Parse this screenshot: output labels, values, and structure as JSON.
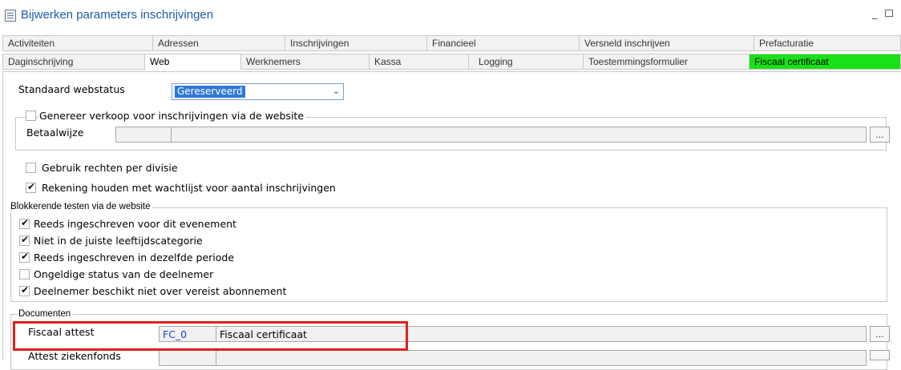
{
  "window": {
    "title": "Bijwerken parameters inschrijvingen"
  },
  "tabs_row1": [
    "Activiteiten",
    "Adressen",
    "Inschrijvingen",
    "Financieel",
    "Versneld inschrijven",
    "Prefacturatie"
  ],
  "tabs_row2": [
    "Daginschrijving",
    "Web",
    "Werknemers",
    "Kassa",
    "Logging",
    "Toestemmingsformulier",
    "Fiscaal certificaat"
  ],
  "active_tab": "Web",
  "highlight_color": "#17e217",
  "web": {
    "status_label": "Standaard webstatus",
    "status_value": "Gereserveerd",
    "sales_group_label": "Genereer verkoop voor inschrijvingen via de website",
    "payment_label": "Betaalwijze",
    "division_rights_label": "Gebruik rechten per divisie",
    "waitlist_label": "Rekening houden met wachtlijst voor aantal inschrijvingen",
    "browse_label": "..."
  },
  "blocking": {
    "title": "Blokkerende testen via de website",
    "items": [
      {
        "label": "Reeds ingeschreven voor dit evenement",
        "checked": true
      },
      {
        "label": "Niet in de juiste leeftijdscategorie",
        "checked": true
      },
      {
        "label": "Reeds ingeschreven in dezelfde periode",
        "checked": true
      },
      {
        "label": "Ongeldige status van de deelnemer",
        "checked": false
      },
      {
        "label": "Deelnemer beschikt niet over vereist abonnement",
        "checked": true
      }
    ]
  },
  "documents": {
    "title": "Documenten",
    "fiscal": {
      "label": "Fiscaal attest",
      "code": "FC_0",
      "description": "Fiscaal certificaat"
    },
    "health": {
      "label": "Attest ziekenfonds",
      "code": "",
      "description": ""
    }
  },
  "accent_red": "#e0201e"
}
